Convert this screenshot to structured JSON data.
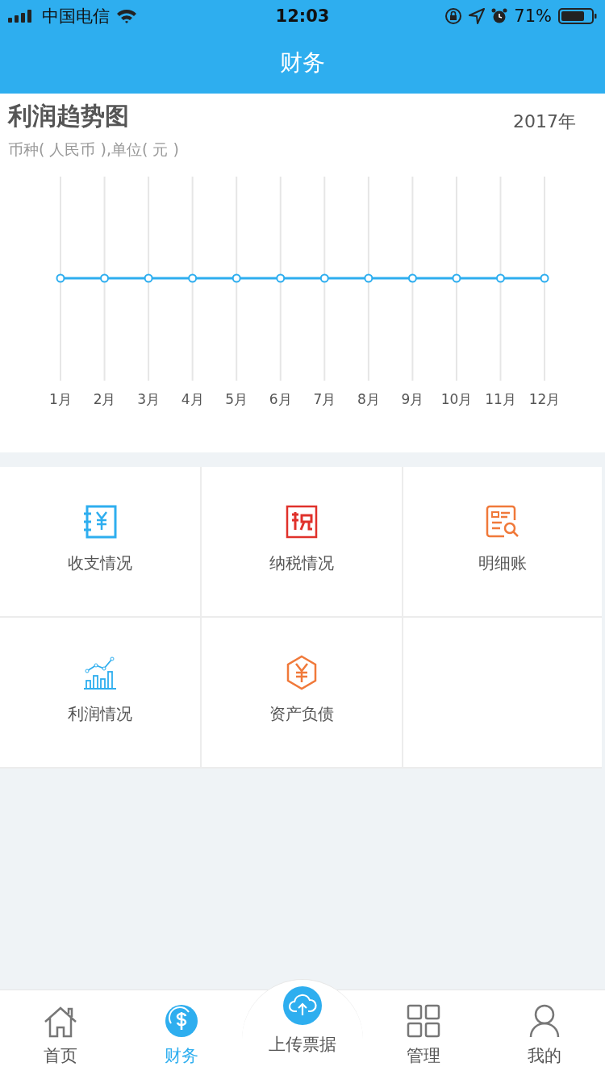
{
  "status_bar": {
    "carrier": "中国电信",
    "time": "12:03",
    "battery": "71%"
  },
  "nav": {
    "title": "财务"
  },
  "chart": {
    "title": "利润趋势图",
    "subtitle": "币种( 人民币 ),单位( 元 )",
    "year": "2017年",
    "months": [
      "1月",
      "2月",
      "3月",
      "4月",
      "5月",
      "6月",
      "7月",
      "8月",
      "9月",
      "10月",
      "11月",
      "12月"
    ]
  },
  "menu": [
    {
      "label": "收支情况"
    },
    {
      "label": "纳税情况"
    },
    {
      "label": "明细账"
    },
    {
      "label": "利润情况"
    },
    {
      "label": "资产负债"
    }
  ],
  "tabbar": [
    {
      "label": "首页",
      "kind": "home",
      "selected": false
    },
    {
      "label": "财务",
      "kind": "finance",
      "selected": true
    },
    {
      "label": "上传票据",
      "kind": "upload",
      "selected": false
    },
    {
      "label": "管理",
      "kind": "manage",
      "selected": false
    },
    {
      "label": "我的",
      "kind": "profile",
      "selected": false
    }
  ]
}
